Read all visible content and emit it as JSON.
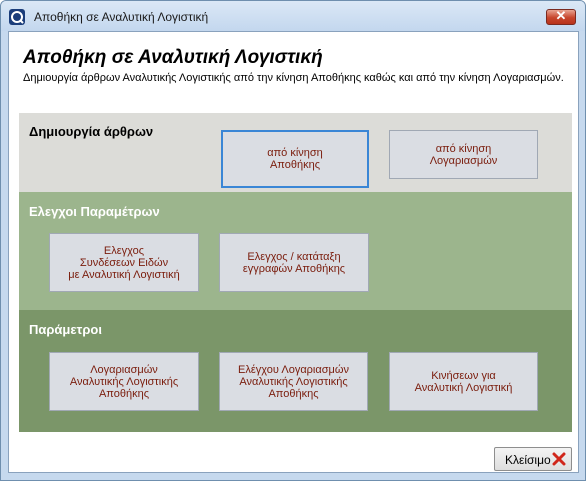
{
  "window": {
    "title": "Αποθήκη σε Αναλυτική Λογιστική",
    "close_glyph": "✕"
  },
  "header": {
    "title": "Αποθήκη σε Αναλυτική Λογιστική",
    "description": "Δημιουργία άρθρων Αναλυτικής Λογιστικής από την κίνηση Αποθήκης καθώς και από την κίνηση Λογαριασμών."
  },
  "sections": [
    {
      "label": "Δημιουργία άρθρων",
      "buttons": [
        "από κίνηση\nΑποθήκης",
        "από κίνηση\nΛογαριασμών"
      ]
    },
    {
      "label": "Ελεγχοι Παραμέτρων",
      "buttons": [
        "Ελεγχος\nΣυνδέσεων Ειδών\nμε Αναλυτική Λογιστική",
        "Ελεγχος / κατάταξη\nεγγραφών Αποθήκης"
      ]
    },
    {
      "label": "Παράμετροι",
      "buttons": [
        "Λογαριασμών\nΑναλυτικής Λογιστικής\nΑποθήκης",
        "Ελέγχου Λογαριασμών\nΑναλυτικής Λογιστικής\nΑποθήκης",
        "Κινήσεων για\nΑναλυτική Λογιστική"
      ]
    }
  ],
  "footer": {
    "close_label": "Κλείσιμο"
  },
  "colors": {
    "button_text": "#7a1c0c",
    "section1_bg": "#dcdcd8",
    "section2_bg": "#9cb58d",
    "section3_bg": "#7b9669",
    "focus_border": "#3a86d6",
    "close_x": "#d0261a"
  },
  "icons": {
    "app": "app-logo-icon",
    "close": "close-x-icon"
  }
}
